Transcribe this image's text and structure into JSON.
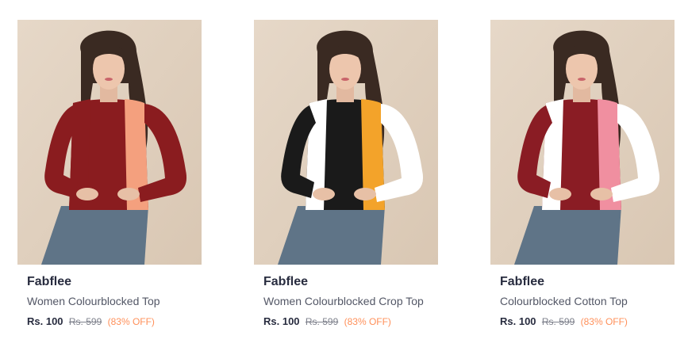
{
  "products": [
    {
      "brand": "Fabflee",
      "name": "Women Colourblocked Top",
      "price": "Rs. 100",
      "mrp": "Rs. 599",
      "discount": "(83% OFF)",
      "colors": {
        "left": "#8a1c1f",
        "center": "#8a1c1f",
        "right": "#f4a07e",
        "rightSleeve": "#8a1c1f",
        "leftSleeve": "#8a1c1f"
      }
    },
    {
      "brand": "Fabflee",
      "name": "Women Colourblocked Crop Top",
      "price": "Rs. 100",
      "mrp": "Rs. 599",
      "discount": "(83% OFF)",
      "colors": {
        "left": "#ffffff",
        "center": "#1a1a1a",
        "right": "#f3a32a",
        "rightSleeve": "#ffffff",
        "leftSleeve": "#1a1a1a"
      }
    },
    {
      "brand": "Fabflee",
      "name": "Colourblocked Cotton Top",
      "price": "Rs. 100",
      "mrp": "Rs. 599",
      "discount": "(83% OFF)",
      "colors": {
        "left": "#ffffff",
        "center": "#8a1c24",
        "right": "#f08fa0",
        "rightSleeve": "#ffffff",
        "leftSleeve": "#8a1c24"
      }
    }
  ]
}
